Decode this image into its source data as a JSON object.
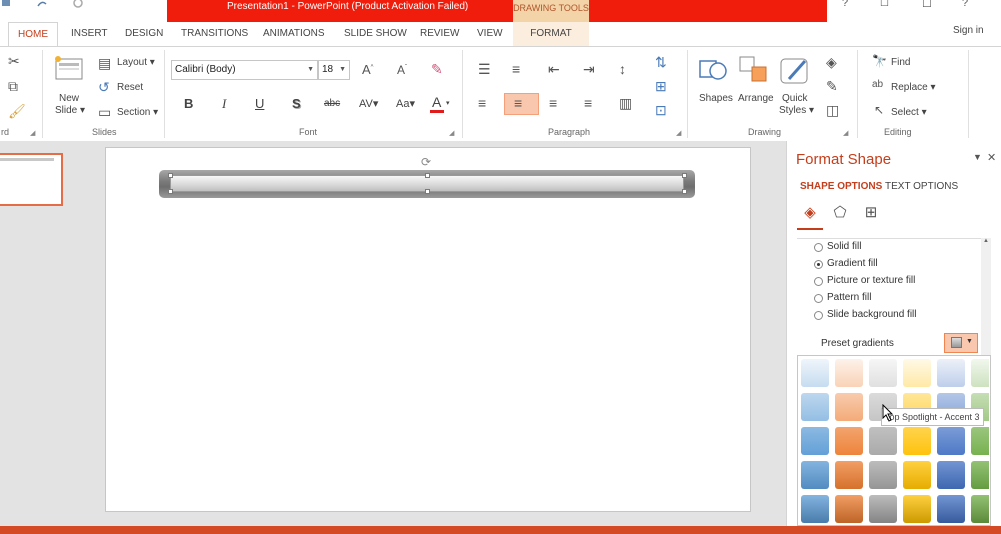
{
  "window": {
    "title": "Presentation1 -  PowerPoint (Product Activation Failed)",
    "contextual_group": "DRAWING TOOLS",
    "controls": {
      "minimize": "?",
      "restore": "☐",
      "maximize": "☐",
      "close": "?"
    },
    "signin": "Sign in"
  },
  "tabs": {
    "home": "HOME",
    "insert": "INSERT",
    "design": "DESIGN",
    "transitions": "TRANSITIONS",
    "animations": "ANIMATIONS",
    "slideshow": "SLIDE SHOW",
    "review": "REVIEW",
    "view": "VIEW",
    "format": "FORMAT"
  },
  "ribbon": {
    "clipboard": {
      "label": "rd"
    },
    "slides": {
      "label": "Slides",
      "new_slide_1": "New",
      "new_slide_2": "Slide ▾",
      "layout": "Layout ▾",
      "reset": "Reset",
      "section": "Section ▾"
    },
    "font": {
      "label": "Font",
      "font_name": "Calibri (Body)",
      "font_size": "18",
      "bold": "B",
      "italic": "I",
      "underline": "U",
      "shadow": "S",
      "strike": "abc",
      "spacing": "AV▾",
      "case": "Aa▾",
      "color": "A"
    },
    "paragraph": {
      "label": "Paragraph"
    },
    "drawing": {
      "label": "Drawing",
      "shapes": "Shapes",
      "arrange": "Arrange",
      "quick_styles_1": "Quick",
      "quick_styles_2": "Styles ▾"
    },
    "editing": {
      "label": "Editing",
      "find": "Find",
      "replace": "Replace ▾",
      "select": "Select ▾"
    }
  },
  "format_pane": {
    "title": "Format Shape",
    "tab_shape": "SHAPE OPTIONS",
    "tab_text": "TEXT OPTIONS",
    "fill_options": [
      {
        "label": "Solid fill",
        "selected": false
      },
      {
        "label": "Gradient fill",
        "selected": true
      },
      {
        "label": "Picture or texture fill",
        "selected": false
      },
      {
        "label": "Pattern fill",
        "selected": false
      },
      {
        "label": "Slide background fill",
        "selected": false
      }
    ],
    "preset_label": "Preset gradients",
    "tooltip": "Top Spotlight - Accent 3"
  },
  "colors": {
    "accent": "#c43e1c",
    "title_bar": "#f01c0c",
    "gradient_columns": [
      "#5b9bd5",
      "#ed7d31",
      "#a5a5a5",
      "#ffc000",
      "#4472c4",
      "#70ad47"
    ]
  }
}
